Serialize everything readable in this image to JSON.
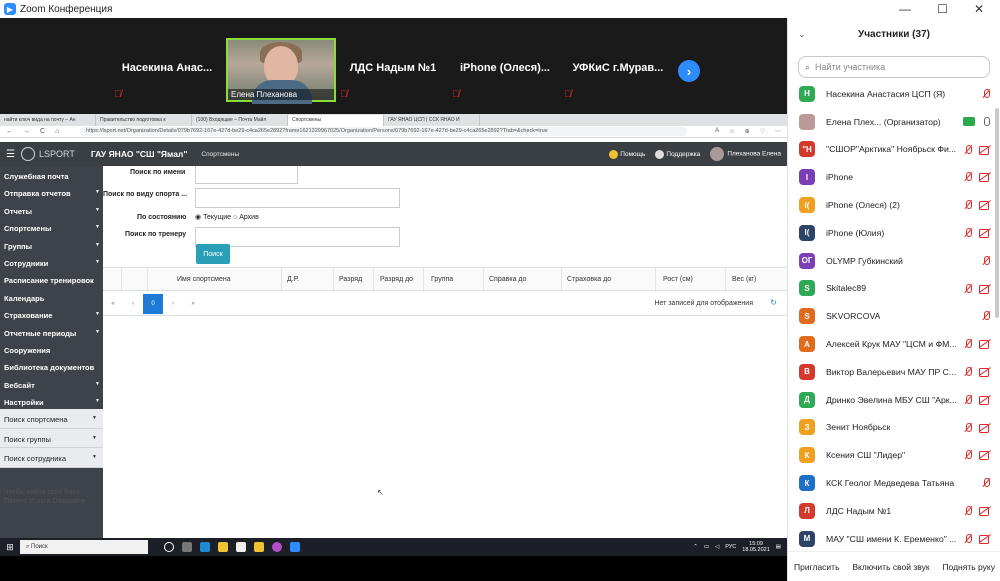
{
  "window": {
    "title": "Zoom Конференция",
    "minimize": "—",
    "maximize": "☐",
    "close": "✕"
  },
  "video": {
    "tiles": [
      {
        "name": "Насекина  Анас..."
      },
      {
        "name": "ЛДС Надым №1"
      },
      {
        "name": "iPhone  (Олеся)..."
      },
      {
        "name": "УФКиС  г.Мурав..."
      }
    ],
    "speaker_label": "Елена Плеханова",
    "next": "›"
  },
  "browser": {
    "tabs": [
      "найти ключ вида на почту – Ан",
      "Правительство подготовка к",
      "(100) Входящие – Почта Майл",
      "Спортсмены",
      "ГАУ ЯНАО ЦСП | ССК ЯНАО И"
    ],
    "nav": {
      "back": "←",
      "forward": "→",
      "reload": "C",
      "home": "⌂"
    },
    "url": "https://lsport.net/Organization/Details/079b7692-167e-427d-be29-c4ca265e2892?frame1621329967025/Organization/Persons/079b7692-167e-427d-be29-c4ca265e2892?Ttab=&check=true",
    "exts": [
      "A",
      "☆",
      "⊕",
      "♡",
      "⋯"
    ]
  },
  "app": {
    "logo": "LSPORT",
    "org": "ГАУ ЯНАО \"СШ \"Ямал\"",
    "crumb": "Спортсмены",
    "help": "Помощь",
    "support": "Поддержка",
    "user": "Плеханова Елена"
  },
  "sidebar": {
    "items": [
      {
        "label": "Служебная почта",
        "caret": ""
      },
      {
        "label": "Отправка отчетов",
        "caret": "▼"
      },
      {
        "label": "Отчеты",
        "caret": "▼"
      },
      {
        "label": "Спортсмены",
        "caret": "▼"
      },
      {
        "label": "Группы",
        "caret": "▼"
      },
      {
        "label": "Сотрудники",
        "caret": "▼"
      },
      {
        "label": "Расписание тренировок",
        "caret": ""
      },
      {
        "label": "Календарь",
        "caret": ""
      },
      {
        "label": "Страхование",
        "caret": "▼"
      },
      {
        "label": "Отчетные периоды",
        "caret": "▼"
      },
      {
        "label": "Сооружения",
        "caret": ""
      },
      {
        "label": "Библиотека документов",
        "caret": ""
      },
      {
        "label": "Вебсайт",
        "caret": "▼"
      },
      {
        "label": "Настройки",
        "caret": "▼"
      }
    ],
    "searches": [
      {
        "label": "Поиск спортсмена",
        "caret": "▼"
      },
      {
        "label": "Поиск группы",
        "caret": "▼"
      },
      {
        "label": "Поиск сотрудника",
        "caret": "▼"
      }
    ],
    "ghost": "Чтобы найти свой Банк\nПатент Услуги Ожидайте"
  },
  "filters": {
    "by_name": "Поиск по имени",
    "by_sport": "Поиск по виду спорта ...",
    "by_state": "По состоянию",
    "state_current": "Текущие",
    "state_archive": "Архив",
    "by_coach": "Поиск по тренеру",
    "search_btn": "Поиск"
  },
  "table": {
    "columns": [
      "Имя спортсмена",
      "Д.Р.",
      "Разряд",
      "Разряд до",
      "Группа",
      "Справка до",
      "Страховка до",
      "Рост (см)",
      "Вес (кг)"
    ],
    "empty": "Нет записей для отображения",
    "page": "0",
    "pager": {
      "first": "«",
      "prev": "‹",
      "next": "›",
      "last": "»"
    },
    "refresh": "↻"
  },
  "taskbar": {
    "start": "⊞",
    "search": "Поиск",
    "lang": "РУС",
    "time": "15:09",
    "date": "18.05.2021"
  },
  "participants": {
    "title": "Участники (37)",
    "search_placeholder": "Найти участника",
    "list": [
      {
        "initial": "Н",
        "name": "Насекина Анастасия ЦСП (Я)",
        "color": "#2faa54",
        "cam": "none",
        "mic": "muted"
      },
      {
        "initial": "",
        "name": "Елена Плех... (Организатор)",
        "color": "#b99",
        "cam": "on",
        "mic": "on"
      },
      {
        "initial": "\"Н",
        "name": "\"СШОР\"Арктика\" Ноябрьск Фи...",
        "color": "#d33a2c",
        "cam": "off",
        "mic": "muted"
      },
      {
        "initial": "I",
        "name": "iPhone",
        "color": "#7b3fb5",
        "cam": "off",
        "mic": "muted"
      },
      {
        "initial": "I(",
        "name": "iPhone (Олеся) (2)",
        "color": "#f0a020",
        "cam": "off",
        "mic": "muted"
      },
      {
        "initial": "I(",
        "name": "iPhone (Юлия)",
        "color": "#2d4466",
        "cam": "off",
        "mic": "muted"
      },
      {
        "initial": "ОГ",
        "name": "OLYMP Губкинский",
        "color": "#7b3fb5",
        "cam": "none",
        "mic": "muted"
      },
      {
        "initial": "S",
        "name": "Skitalec89",
        "color": "#2faa54",
        "cam": "off",
        "mic": "muted"
      },
      {
        "initial": "S",
        "name": "SKVORCOVA",
        "color": "#e06b1c",
        "cam": "none",
        "mic": "muted"
      },
      {
        "initial": "А",
        "name": "Алексей Крук МАУ \"ЦСМ и ФМ...",
        "color": "#e06b1c",
        "cam": "off",
        "mic": "muted"
      },
      {
        "initial": "В",
        "name": "Виктор Валерьевич МАУ ПР С...",
        "color": "#d33a2c",
        "cam": "off",
        "mic": "muted"
      },
      {
        "initial": "Д",
        "name": "Дринко Эвелина МБУ СШ \"Арк...",
        "color": "#2faa54",
        "cam": "off",
        "mic": "muted"
      },
      {
        "initial": "З",
        "name": "Зенит Ноябрьск",
        "color": "#f0a020",
        "cam": "off",
        "mic": "muted"
      },
      {
        "initial": "К",
        "name": "Ксения СШ \"Лидер\"",
        "color": "#f0a020",
        "cam": "off",
        "mic": "muted"
      },
      {
        "initial": "К",
        "name": "КСК Геолог Медведева Татьяна",
        "color": "#1e6fc8",
        "cam": "none",
        "mic": "muted"
      },
      {
        "initial": "Л",
        "name": "ЛДС Надым №1",
        "color": "#d33a2c",
        "cam": "off",
        "mic": "muted"
      },
      {
        "initial": "М",
        "name": "МАУ \"СШ имени К. Еременко\" ...",
        "color": "#2d4466",
        "cam": "off",
        "mic": "muted"
      }
    ],
    "invite": "Пригласить",
    "unmute_all": "Включить свой звук",
    "raise_hand": "Поднять руку"
  }
}
